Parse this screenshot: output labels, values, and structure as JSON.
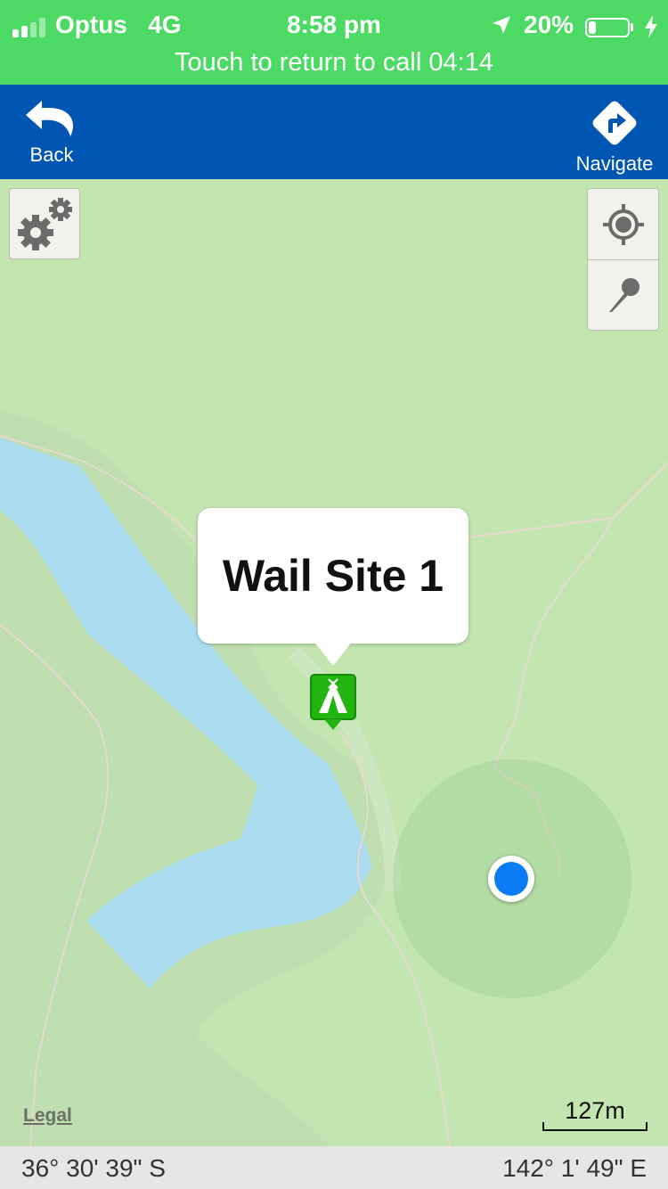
{
  "status_bar": {
    "carrier": "Optus",
    "network": "4G",
    "time": "8:58 pm",
    "battery_percent_text": "20%",
    "battery_level": 0.2,
    "call_banner": "Touch to return to call 04:14",
    "background_color": "#4cd964"
  },
  "nav_bar": {
    "back_label": "Back",
    "back_icon": "undo-arrow-icon",
    "navigate_label": "Navigate",
    "navigate_icon": "turn-right-diamond-icon",
    "background_color": "#0156b4"
  },
  "map": {
    "settings_icon": "gears-icon",
    "locate_icon": "crosshair-target-icon",
    "drop_pin_icon": "map-pin-icon",
    "callout_title": "Wail Site 1",
    "marker_icon": "campsite-tent-icon",
    "marker_color": "#22b510",
    "user_location_color": "#0a7af5",
    "legal_label": "Legal",
    "scale_label": "127m",
    "land_color": "#c3e6b1",
    "water_color": "#abdcef"
  },
  "coordinates": {
    "latitude": "36° 30' 39\" S",
    "longitude": "142° 1' 49\" E"
  }
}
